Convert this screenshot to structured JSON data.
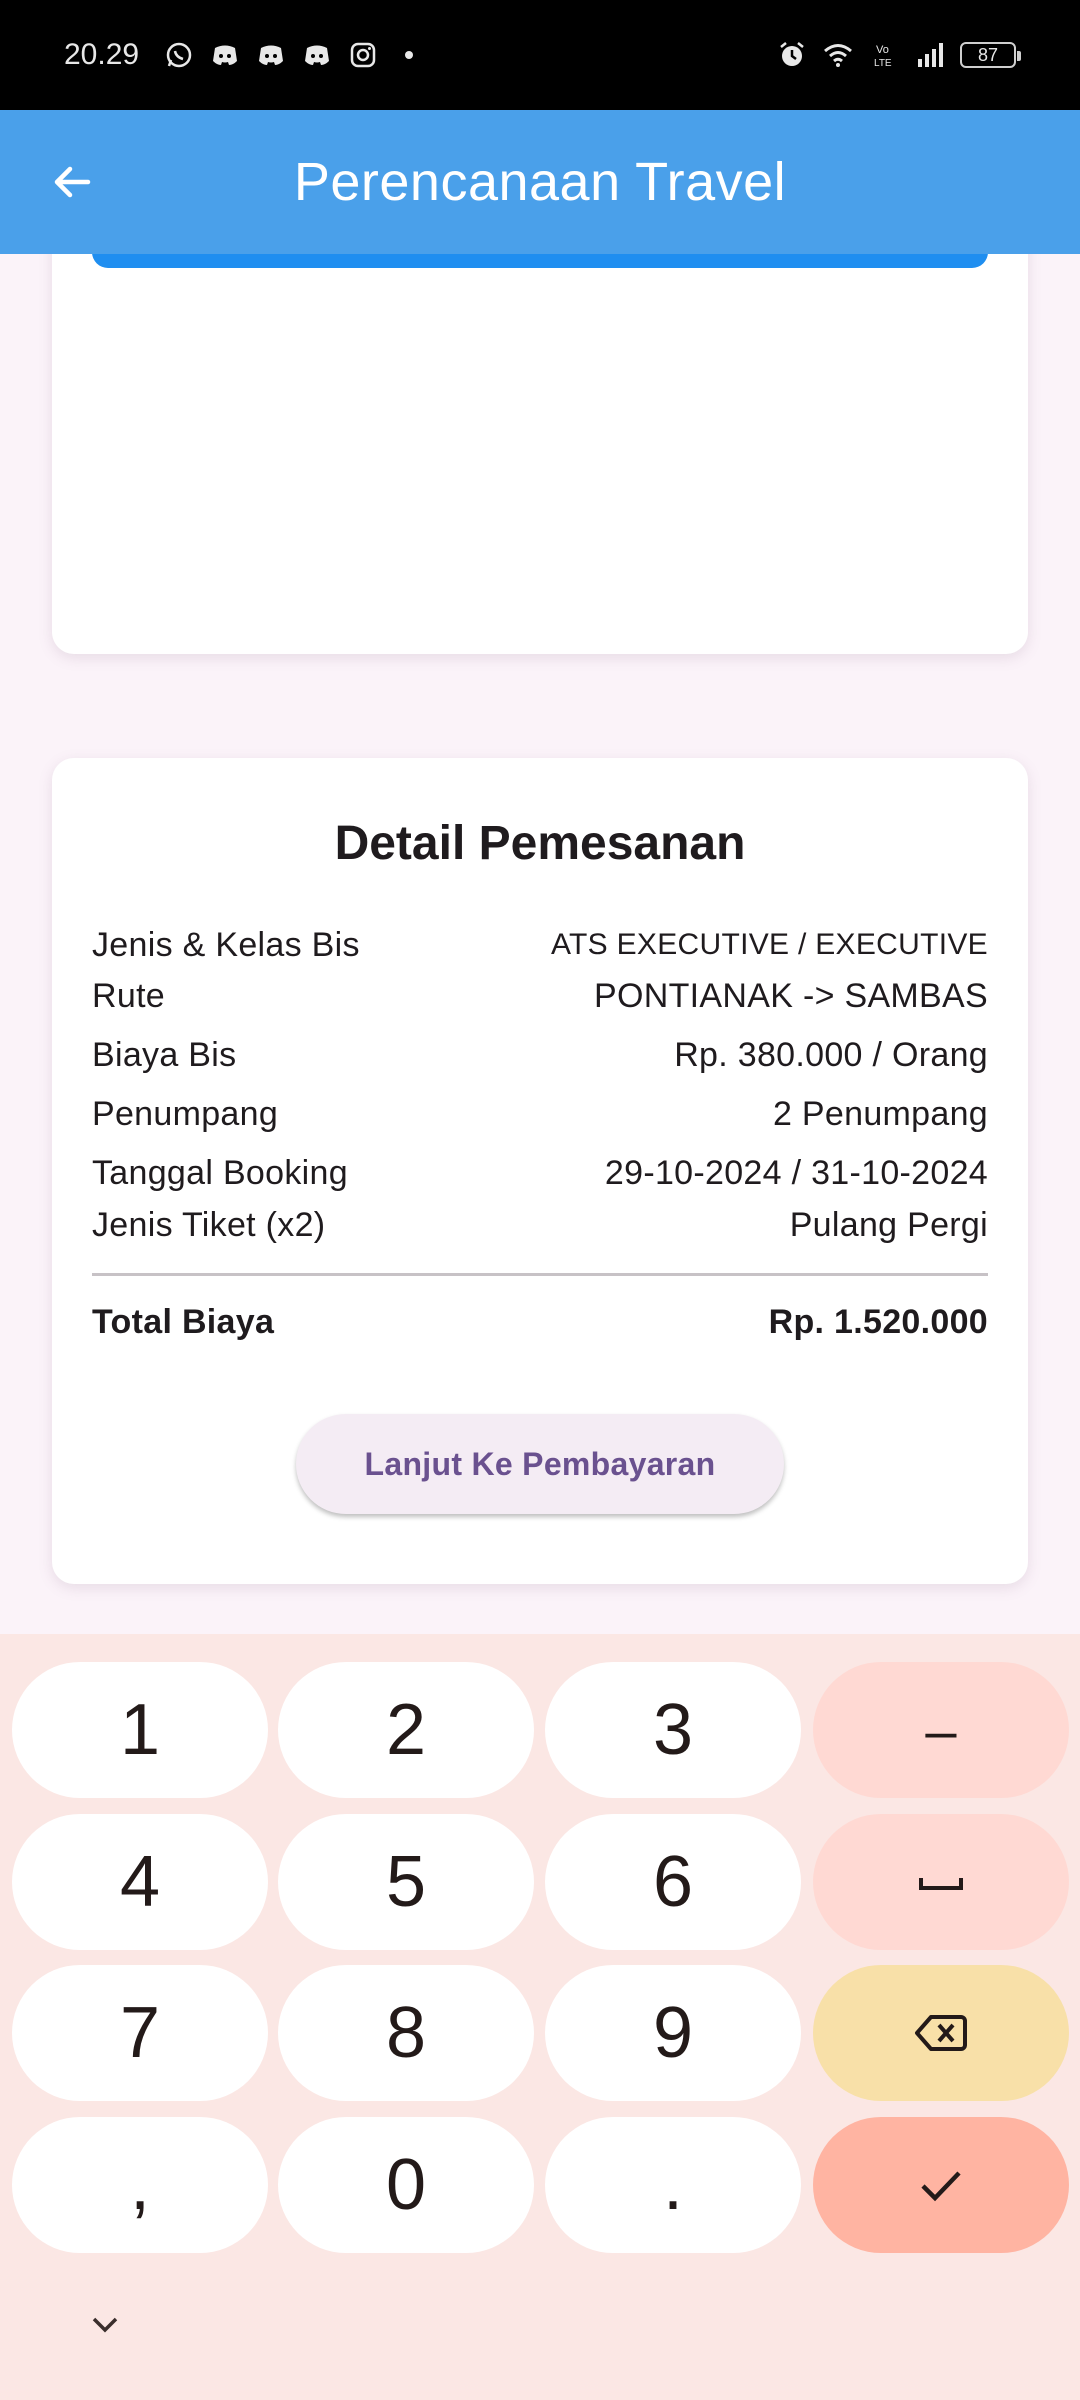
{
  "status_bar": {
    "time": "20.29",
    "battery": "87",
    "left_icons": [
      "whatsapp-icon",
      "discord-icon",
      "discord-icon",
      "discord-icon",
      "instagram-icon",
      "dot-icon"
    ],
    "right_icons": [
      "alarm-icon",
      "wifi-icon",
      "volte-icon",
      "signal-icon",
      "battery-icon"
    ]
  },
  "app_bar": {
    "title": "Perencanaan Travel",
    "color": "#4aa0ea"
  },
  "detail": {
    "title": "Detail Pemesanan",
    "rows": [
      {
        "label": "Jenis & Kelas Bis",
        "value": "ATS EXECUTIVE / EXECUTIVE"
      },
      {
        "label": "Rute",
        "value": "PONTIANAK -> SAMBAS"
      },
      {
        "label": "Biaya Bis",
        "value": "Rp. 380.000 / Orang"
      },
      {
        "label": "Penumpang",
        "value": "2 Penumpang"
      },
      {
        "label": "Tanggal Booking",
        "value": "29-10-2024 / 31-10-2024"
      },
      {
        "label": "Jenis Tiket (x2)",
        "value": "Pulang Pergi"
      }
    ],
    "total_label": "Total Biaya",
    "total_value": "Rp. 1.520.000",
    "pay_button": "Lanjut Ke Pembayaran"
  },
  "keyboard": {
    "keys": [
      "1",
      "2",
      "3",
      "–",
      "4",
      "5",
      "6",
      "␣",
      "7",
      "8",
      "9",
      "⌫",
      ",",
      "0",
      ".",
      "✓"
    ]
  }
}
